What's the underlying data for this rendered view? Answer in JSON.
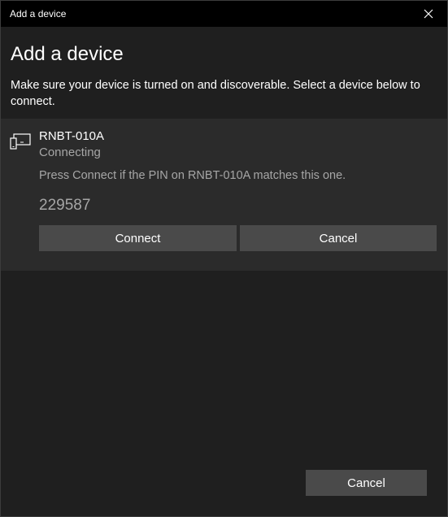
{
  "window": {
    "title": "Add a device",
    "close_icon": "close-icon"
  },
  "main": {
    "heading": "Add a device",
    "instructions": "Make sure your device is turned on and discoverable. Select a device below to connect."
  },
  "device": {
    "icon": "device-icon",
    "name": "RNBT-010A",
    "status": "Connecting",
    "pin_prompt": "Press Connect if the PIN on RNBT-010A matches this one.",
    "pin": "229587",
    "connect_label": "Connect",
    "cancel_label": "Cancel"
  },
  "footer": {
    "cancel_label": "Cancel"
  },
  "colors": {
    "window_background": "#1f1f1f",
    "titlebar": "#000000",
    "panel": "#2b2b2b",
    "button": "#4a4a4a",
    "secondary_text": "#a6a6a6"
  }
}
